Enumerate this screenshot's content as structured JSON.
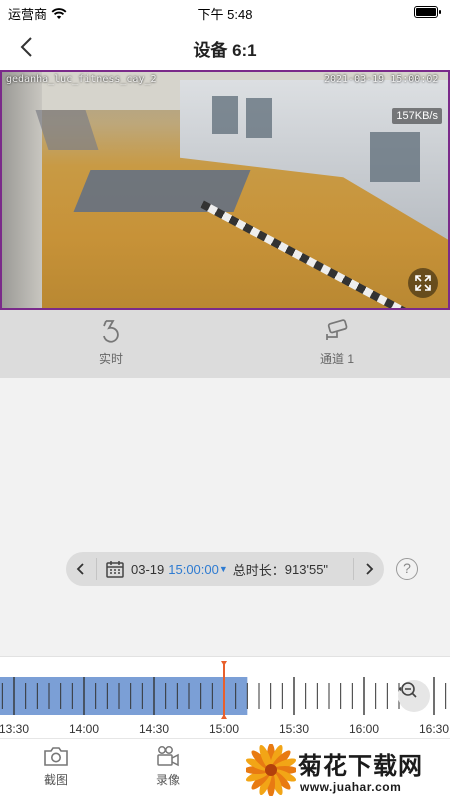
{
  "status_bar": {
    "carrier": "运营商",
    "time": "下午 5:48"
  },
  "nav": {
    "title": "设备 6:1"
  },
  "video": {
    "osd_name": "gedanha_luc_fitness_cay_2",
    "osd_timestamp": "2021-03-19 15:00:02",
    "bitrate": "157KB/s"
  },
  "modes": {
    "realtime_label": "实时",
    "channel_label": "通道 1"
  },
  "playback": {
    "date": "03-19",
    "time": "15:00:00",
    "duration_label": "总时长：",
    "duration_value": "913'55\""
  },
  "timeline": {
    "ticks": [
      "13:30",
      "14:00",
      "14:30",
      "15:00",
      "15:30",
      "16:00",
      "16:30"
    ],
    "recorded_until": "15:10",
    "cursor": "15:00"
  },
  "toolbar": {
    "screenshot_label": "截图",
    "record_label": "录像"
  },
  "watermark": {
    "title": "菊花下载网",
    "url": "www.juahar.com"
  },
  "colors": {
    "accent": "#2e7bd1",
    "recorded": "#7b9fd6",
    "cursor": "#e8602c",
    "video_border": "#7a2a8a"
  }
}
